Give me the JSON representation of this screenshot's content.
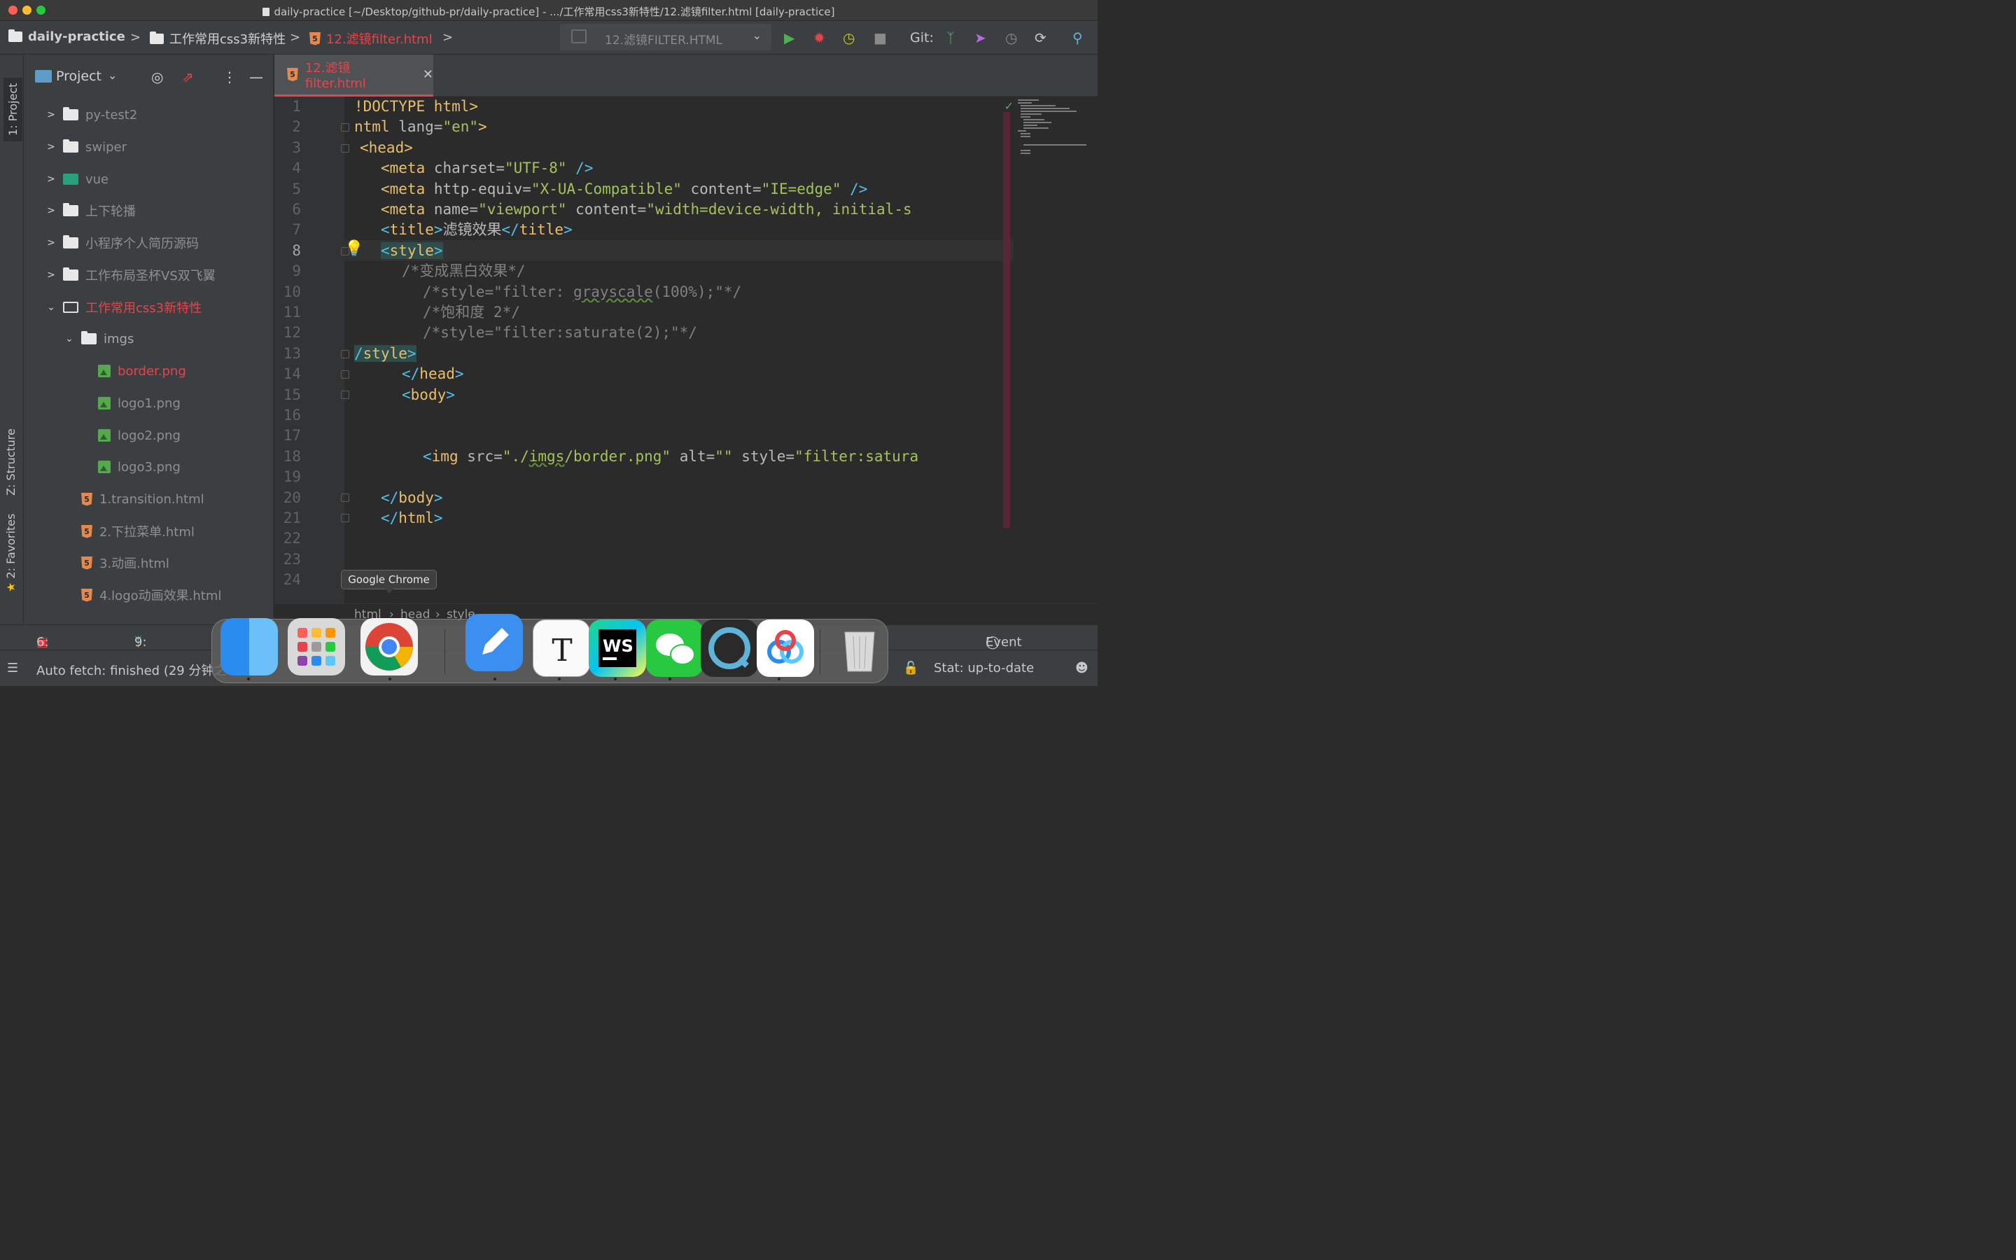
{
  "window": {
    "title": "daily-practice [~/Desktop/github-pr/daily-practice] - .../工作常用css3新特性/12.滤镜filter.html [daily-practice]"
  },
  "navbar": {
    "crumbs": [
      "daily-practice",
      "工作常用css3新特性",
      "12.滤镜filter.html"
    ],
    "run_config": "12.滤镜FILTER.HTML",
    "git_label": "Git:"
  },
  "side_tabs": {
    "project": "1: Project",
    "structure": "Z: Structure",
    "favorites": "2: Favorites"
  },
  "sidebar": {
    "title": "Project",
    "items": [
      {
        "label": "py-test2"
      },
      {
        "label": "swiper"
      },
      {
        "label": "vue"
      },
      {
        "label": "上下轮播"
      },
      {
        "label": "小程序个人简历源码"
      },
      {
        "label": "工作布局圣杯VS双飞翼"
      },
      {
        "label": "工作常用css3新特性"
      },
      {
        "label": "imgs"
      },
      {
        "label": "border.png"
      },
      {
        "label": "logo1.png"
      },
      {
        "label": "logo2.png"
      },
      {
        "label": "logo3.png"
      },
      {
        "label": "1.transition.html"
      },
      {
        "label": "2.下拉菜单.html"
      },
      {
        "label": "3.动画.html"
      },
      {
        "label": "4.logo动画效果.html"
      }
    ]
  },
  "editor": {
    "tab_label": "12.滤镜filter.html",
    "current_line": 8,
    "line_numbers": [
      "1",
      "2",
      "3",
      "4",
      "5",
      "6",
      "7",
      "8",
      "9",
      "10",
      "11",
      "12",
      "13",
      "14",
      "15",
      "16",
      "17",
      "18",
      "19",
      "20",
      "21",
      "22",
      "23",
      "24"
    ]
  },
  "breadcrumb": {
    "a": "html",
    "b": "head",
    "c": "style"
  },
  "tooltip": {
    "text": "Google Chrome"
  },
  "bottom_tabs": {
    "todo": "6: TODO",
    "version": "9: Version",
    "event_log": "Event Log"
  },
  "status": {
    "left": "Auto fetch: finished (29 分钟之",
    "git": "Stat: up-to-date"
  },
  "colors": {
    "accent_red": "#e8434b",
    "bg": "#2b2b2b",
    "panel": "#3c3f41"
  }
}
